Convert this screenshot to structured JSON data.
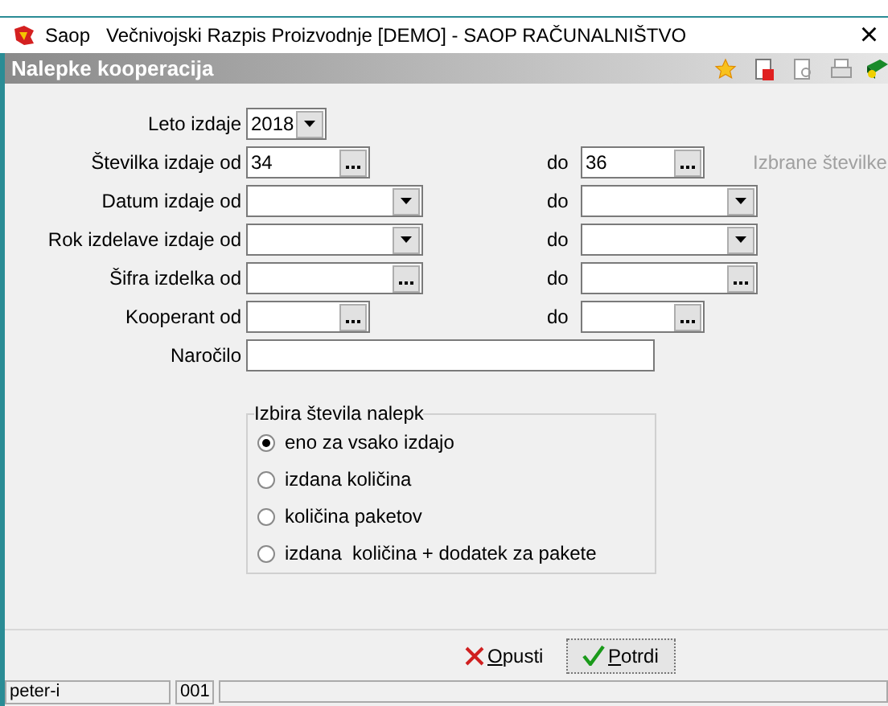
{
  "window": {
    "title": "Saop   Večnivojski Razpis Proizvodnje [DEMO] - SAOP RAČUNALNIŠTVO",
    "close": "×"
  },
  "header": {
    "title": "Nalepke kooperacija"
  },
  "form": {
    "rows": [
      {
        "label": "Leto izdaje",
        "from": {
          "kind": "year",
          "value": "2018"
        }
      },
      {
        "label": "Številka izdaje od",
        "from": {
          "kind": "lookup",
          "value": "34"
        },
        "to_label": "do",
        "to": {
          "kind": "lookup",
          "value": "36"
        },
        "note": "Izbrane številke"
      },
      {
        "label": "Datum izdaje od",
        "from": {
          "kind": "combo"
        },
        "to_label": "do",
        "to": {
          "kind": "combo"
        }
      },
      {
        "label": "Rok izdelave izdaje od",
        "from": {
          "kind": "combo"
        },
        "to_label": "do",
        "to": {
          "kind": "combo"
        }
      },
      {
        "label": "Šifra izdelka od",
        "from": {
          "kind": "widelookup"
        },
        "to_label": "do",
        "to": {
          "kind": "widelookup"
        }
      },
      {
        "label": "Kooperant od",
        "from": {
          "kind": "lookup"
        },
        "to_label": "do",
        "to": {
          "kind": "lookup"
        }
      },
      {
        "label": "Naročilo",
        "from": {
          "kind": "text"
        }
      }
    ]
  },
  "group": {
    "title": "Izbira števila nalepk",
    "options": [
      {
        "label": "eno za vsako izdajo",
        "selected": true
      },
      {
        "label": "izdana količina",
        "selected": false
      },
      {
        "label": "količina paketov",
        "selected": false
      },
      {
        "label": "izdana  količina + dodatek za pakete",
        "selected": false
      }
    ]
  },
  "buttons": [
    {
      "kind": "cancel",
      "label": "Opusti"
    },
    {
      "kind": "confirm",
      "label": "Potrdi"
    }
  ],
  "status_bar": [
    "peter-i",
    "001"
  ]
}
